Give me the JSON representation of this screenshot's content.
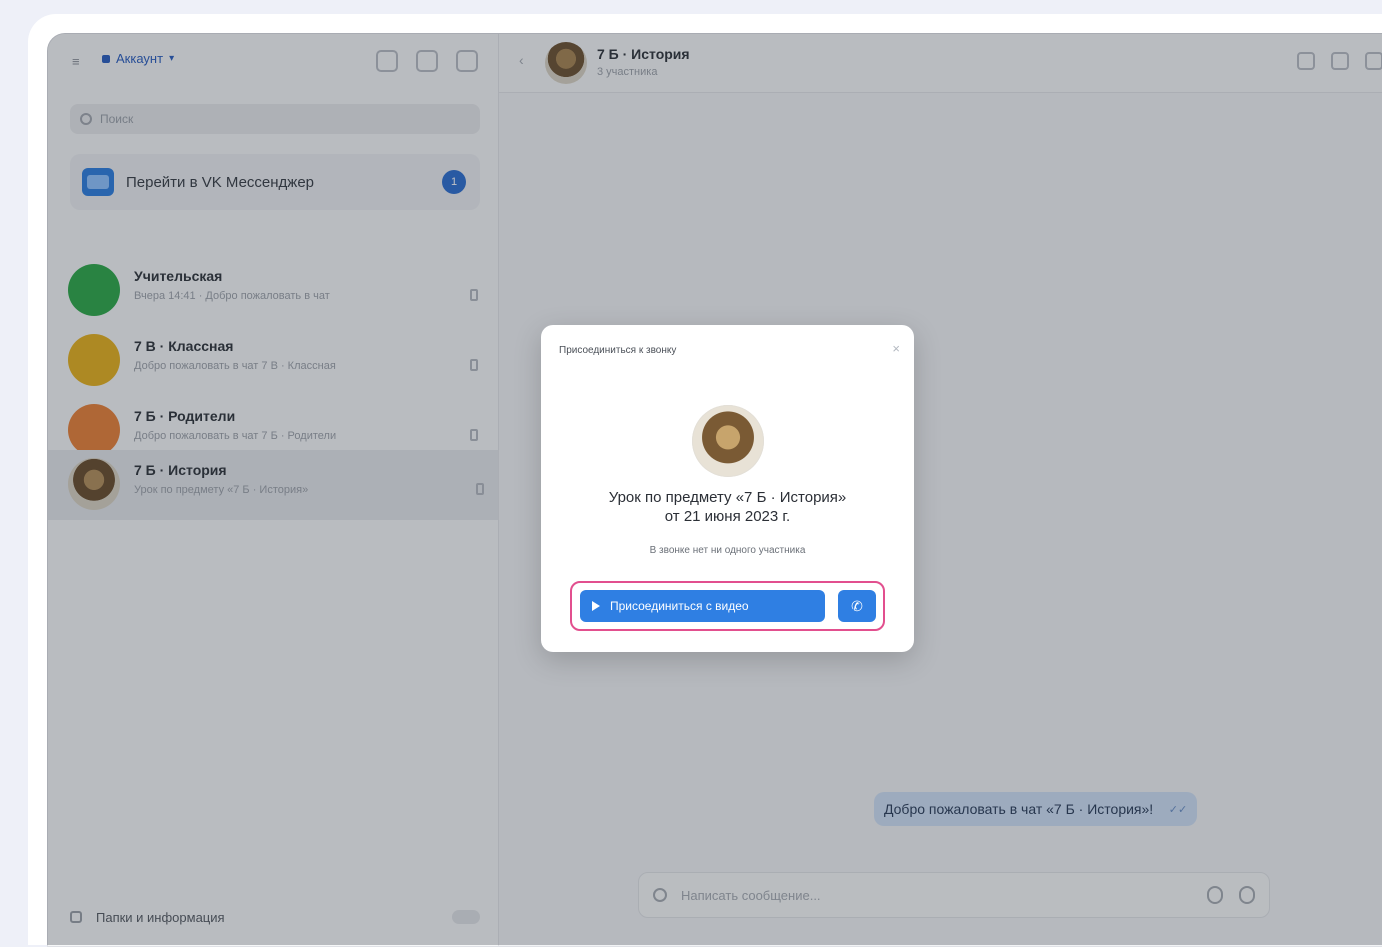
{
  "sidebar": {
    "account_label": "Аккаунт",
    "search_placeholder": "Поиск",
    "promo_label": "Перейти в VK Мессенджер",
    "promo_badge": "1",
    "chats": [
      {
        "name": "Учительская",
        "preview": "Вчера 14:41 · Добро пожаловать в чат",
        "time": "",
        "avatar_color": "#2ea84a"
      },
      {
        "name": "7 В · Классная",
        "preview": "Добро пожаловать в чат 7 В · Классная",
        "time": "",
        "avatar_color": "#e5b11f"
      },
      {
        "name": "7 Б · Родители",
        "preview": "Добро пожаловать в чат 7 Б · Родители",
        "time": "",
        "avatar_color": "#e8813a"
      },
      {
        "name": "7 Б · История",
        "preview": "Урок по предмету «7 Б · История»",
        "time": "",
        "avatar_color": "#7a5a34"
      }
    ],
    "bottom_label": "Папки и информация"
  },
  "chat": {
    "title": "7 Б · История",
    "subtitle": "3 участника",
    "message": "Добро пожаловать в чат «7 Б · История»!",
    "message_tick": "✓✓",
    "composer_placeholder": "Написать сообщение..."
  },
  "modal": {
    "title": "Присоединиться к звонку",
    "close": "×",
    "heading_line1": "Урок по предмету «7 Б · История»",
    "heading_line2": "от 21 июня 2023 г.",
    "subtitle": "В звонке нет ни одного участника",
    "join_label": "Присоединиться с видео",
    "call_icon": "✆"
  }
}
